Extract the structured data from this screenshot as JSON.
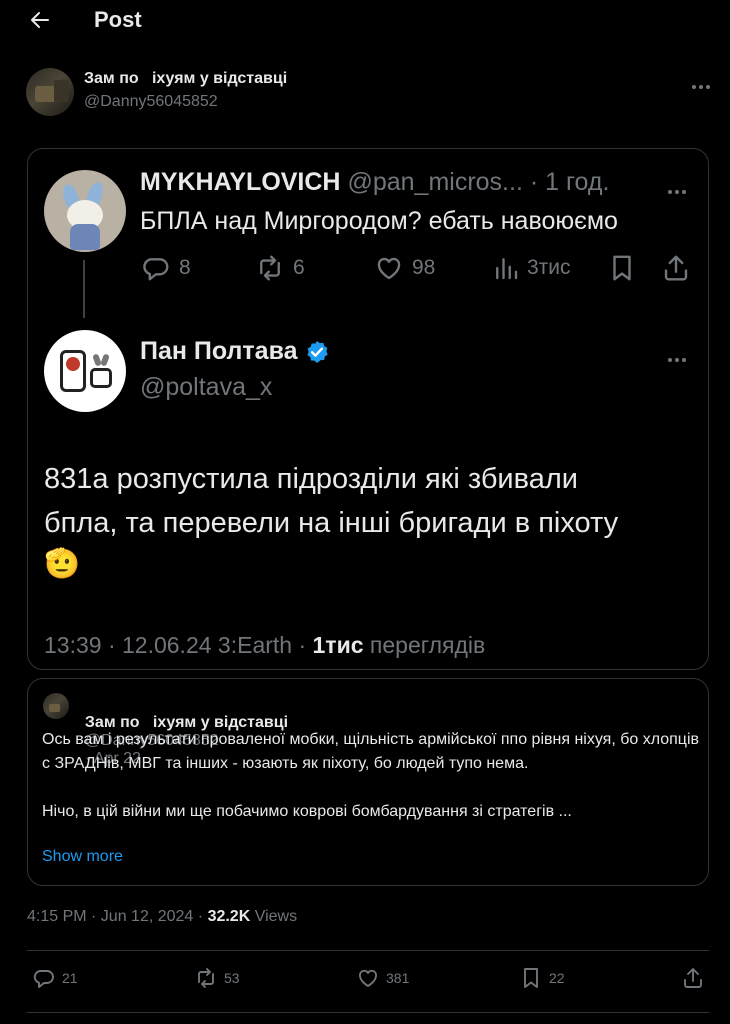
{
  "header": {
    "title": "Post"
  },
  "author": {
    "name": "Зам по   іхуям у відставці",
    "handle": "@Danny56045852"
  },
  "screenshot": {
    "orig": {
      "name": "MYKHAYLOVICH",
      "handle": "@pan_micros...",
      "time": "· 1 год.",
      "text": "БПЛА над Миргородом? ебать навоюємо",
      "replies": "8",
      "reposts": "6",
      "likes": "98",
      "views": "3тис"
    },
    "reply": {
      "name": "Пан Полтава",
      "handle": "@poltava_x",
      "text_line1": "831а розпустила підрозділи які збивали",
      "text_line2": "бпла, та перевели на інші бригади в піхоту",
      "emoji": "🫡",
      "time": "13:39 · 12.06.24 3:Earth ·",
      "views_count": "1тис",
      "views_label": "переглядів"
    }
  },
  "quote": {
    "name": "Зам по   іхуям у відставці",
    "handle": "@Danny56045852",
    "date": "· Apr 22",
    "text1": "Ось вам і результати проваленої мобки, щільність армійської ппо рівня ніхуя, бо хлопців с ЗРАДНів, МВГ та інших - юзають як піхоту, бо людей тупо нема.",
    "text2": "Нічо, в цій війни ми ще побачимо коврові бомбардування зі стратегів ...",
    "show_more": "Show more"
  },
  "meta": {
    "time": "4:15 PM · Jun 12, 2024 ·",
    "views_count": "32.2K",
    "views_label": "Views"
  },
  "actions": {
    "replies": "21",
    "reposts": "53",
    "likes": "381",
    "bookmarks": "22"
  },
  "colors": {
    "background": "#000000",
    "text": "#e7e9ea",
    "muted": "#71767b",
    "link": "#1d9bf0",
    "border": "#2f3336",
    "verified": "#1d9bf0"
  },
  "icons": [
    "back-arrow-icon",
    "more-icon",
    "reply-icon",
    "repost-icon",
    "like-icon",
    "views-icon",
    "bookmark-icon",
    "share-icon",
    "verified-badge-icon",
    "salute-emoji"
  ]
}
